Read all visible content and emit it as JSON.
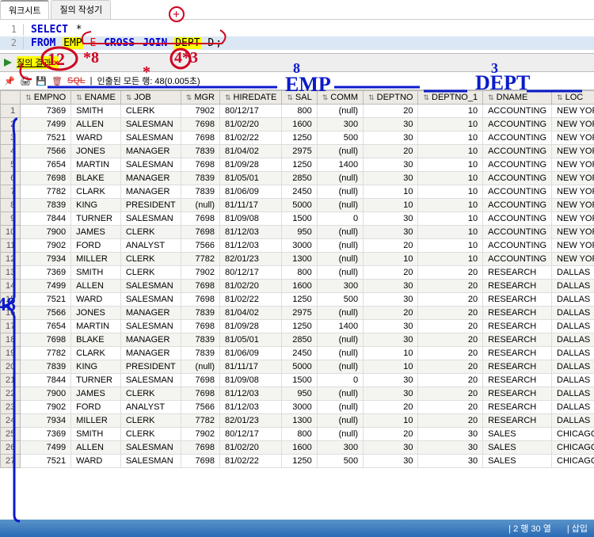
{
  "tabs": {
    "worksheet": "워크시트",
    "querybuilder": "질의 작성기"
  },
  "sql": {
    "line1_select": "SELECT",
    "line1_star": "*",
    "line2_from": "FROM",
    "line2_emp": "EMP",
    "line2_e": "E",
    "line2_cross": "CROSS",
    "line2_join": "JOIN",
    "line2_dept": "DEPT",
    "line2_d": "D",
    "line2_semi": ";"
  },
  "resultbar": {
    "label": "질의 결과",
    "close_x": "×"
  },
  "toolbar2": {
    "sql": "SQL",
    "fetchtext": "인출된 모든 행: 48(0.005초)"
  },
  "annotations": {
    "plus": "+",
    "twelve": "12",
    "eight1": "*8",
    "star": "*",
    "fourthree": "4*3",
    "emp": "EMP",
    "dept": "DEPT",
    "eight2": "8",
    "three": "3",
    "fortyeight": "48"
  },
  "columns": [
    "",
    "EMPNO",
    "ENAME",
    "JOB",
    "MGR",
    "HIREDATE",
    "SAL",
    "COMM",
    "DEPTNO",
    "DEPTNO_1",
    "DNAME",
    "LOC"
  ],
  "rows": [
    [
      1,
      7369,
      "SMITH",
      "CLERK",
      "7902",
      "80/12/17",
      "800",
      "(null)",
      "20",
      "10",
      "ACCOUNTING",
      "NEW YORK"
    ],
    [
      2,
      7499,
      "ALLEN",
      "SALESMAN",
      "7698",
      "81/02/20",
      "1600",
      "300",
      "30",
      "10",
      "ACCOUNTING",
      "NEW YORK"
    ],
    [
      3,
      7521,
      "WARD",
      "SALESMAN",
      "7698",
      "81/02/22",
      "1250",
      "500",
      "30",
      "10",
      "ACCOUNTING",
      "NEW YORK"
    ],
    [
      4,
      7566,
      "JONES",
      "MANAGER",
      "7839",
      "81/04/02",
      "2975",
      "(null)",
      "20",
      "10",
      "ACCOUNTING",
      "NEW YORK"
    ],
    [
      5,
      7654,
      "MARTIN",
      "SALESMAN",
      "7698",
      "81/09/28",
      "1250",
      "1400",
      "30",
      "10",
      "ACCOUNTING",
      "NEW YORK"
    ],
    [
      6,
      7698,
      "BLAKE",
      "MANAGER",
      "7839",
      "81/05/01",
      "2850",
      "(null)",
      "30",
      "10",
      "ACCOUNTING",
      "NEW YORK"
    ],
    [
      7,
      7782,
      "CLARK",
      "MANAGER",
      "7839",
      "81/06/09",
      "2450",
      "(null)",
      "10",
      "10",
      "ACCOUNTING",
      "NEW YORK"
    ],
    [
      8,
      7839,
      "KING",
      "PRESIDENT",
      "(null)",
      "81/11/17",
      "5000",
      "(null)",
      "10",
      "10",
      "ACCOUNTING",
      "NEW YORK"
    ],
    [
      9,
      7844,
      "TURNER",
      "SALESMAN",
      "7698",
      "81/09/08",
      "1500",
      "0",
      "30",
      "10",
      "ACCOUNTING",
      "NEW YORK"
    ],
    [
      10,
      7900,
      "JAMES",
      "CLERK",
      "7698",
      "81/12/03",
      "950",
      "(null)",
      "30",
      "10",
      "ACCOUNTING",
      "NEW YORK"
    ],
    [
      11,
      7902,
      "FORD",
      "ANALYST",
      "7566",
      "81/12/03",
      "3000",
      "(null)",
      "20",
      "10",
      "ACCOUNTING",
      "NEW YORK"
    ],
    [
      12,
      7934,
      "MILLER",
      "CLERK",
      "7782",
      "82/01/23",
      "1300",
      "(null)",
      "10",
      "10",
      "ACCOUNTING",
      "NEW YORK"
    ],
    [
      13,
      7369,
      "SMITH",
      "CLERK",
      "7902",
      "80/12/17",
      "800",
      "(null)",
      "20",
      "20",
      "RESEARCH",
      "DALLAS"
    ],
    [
      14,
      7499,
      "ALLEN",
      "SALESMAN",
      "7698",
      "81/02/20",
      "1600",
      "300",
      "30",
      "20",
      "RESEARCH",
      "DALLAS"
    ],
    [
      15,
      7521,
      "WARD",
      "SALESMAN",
      "7698",
      "81/02/22",
      "1250",
      "500",
      "30",
      "20",
      "RESEARCH",
      "DALLAS"
    ],
    [
      16,
      7566,
      "JONES",
      "MANAGER",
      "7839",
      "81/04/02",
      "2975",
      "(null)",
      "20",
      "20",
      "RESEARCH",
      "DALLAS"
    ],
    [
      17,
      7654,
      "MARTIN",
      "SALESMAN",
      "7698",
      "81/09/28",
      "1250",
      "1400",
      "30",
      "20",
      "RESEARCH",
      "DALLAS"
    ],
    [
      18,
      7698,
      "BLAKE",
      "MANAGER",
      "7839",
      "81/05/01",
      "2850",
      "(null)",
      "30",
      "20",
      "RESEARCH",
      "DALLAS"
    ],
    [
      19,
      7782,
      "CLARK",
      "MANAGER",
      "7839",
      "81/06/09",
      "2450",
      "(null)",
      "10",
      "20",
      "RESEARCH",
      "DALLAS"
    ],
    [
      20,
      7839,
      "KING",
      "PRESIDENT",
      "(null)",
      "81/11/17",
      "5000",
      "(null)",
      "10",
      "20",
      "RESEARCH",
      "DALLAS"
    ],
    [
      21,
      7844,
      "TURNER",
      "SALESMAN",
      "7698",
      "81/09/08",
      "1500",
      "0",
      "30",
      "20",
      "RESEARCH",
      "DALLAS"
    ],
    [
      22,
      7900,
      "JAMES",
      "CLERK",
      "7698",
      "81/12/03",
      "950",
      "(null)",
      "30",
      "20",
      "RESEARCH",
      "DALLAS"
    ],
    [
      23,
      7902,
      "FORD",
      "ANALYST",
      "7566",
      "81/12/03",
      "3000",
      "(null)",
      "20",
      "20",
      "RESEARCH",
      "DALLAS"
    ],
    [
      24,
      7934,
      "MILLER",
      "CLERK",
      "7782",
      "82/01/23",
      "1300",
      "(null)",
      "10",
      "20",
      "RESEARCH",
      "DALLAS"
    ],
    [
      25,
      7369,
      "SMITH",
      "CLERK",
      "7902",
      "80/12/17",
      "800",
      "(null)",
      "20",
      "30",
      "SALES",
      "CHICAGO"
    ],
    [
      26,
      7499,
      "ALLEN",
      "SALESMAN",
      "7698",
      "81/02/20",
      "1600",
      "300",
      "30",
      "30",
      "SALES",
      "CHICAGO"
    ],
    [
      27,
      7521,
      "WARD",
      "SALESMAN",
      "7698",
      "81/02/22",
      "1250",
      "500",
      "30",
      "30",
      "SALES",
      "CHICAGO"
    ]
  ],
  "statusbar": {
    "pos": "| 2 행 30 열",
    "mode": "| 삽입"
  }
}
